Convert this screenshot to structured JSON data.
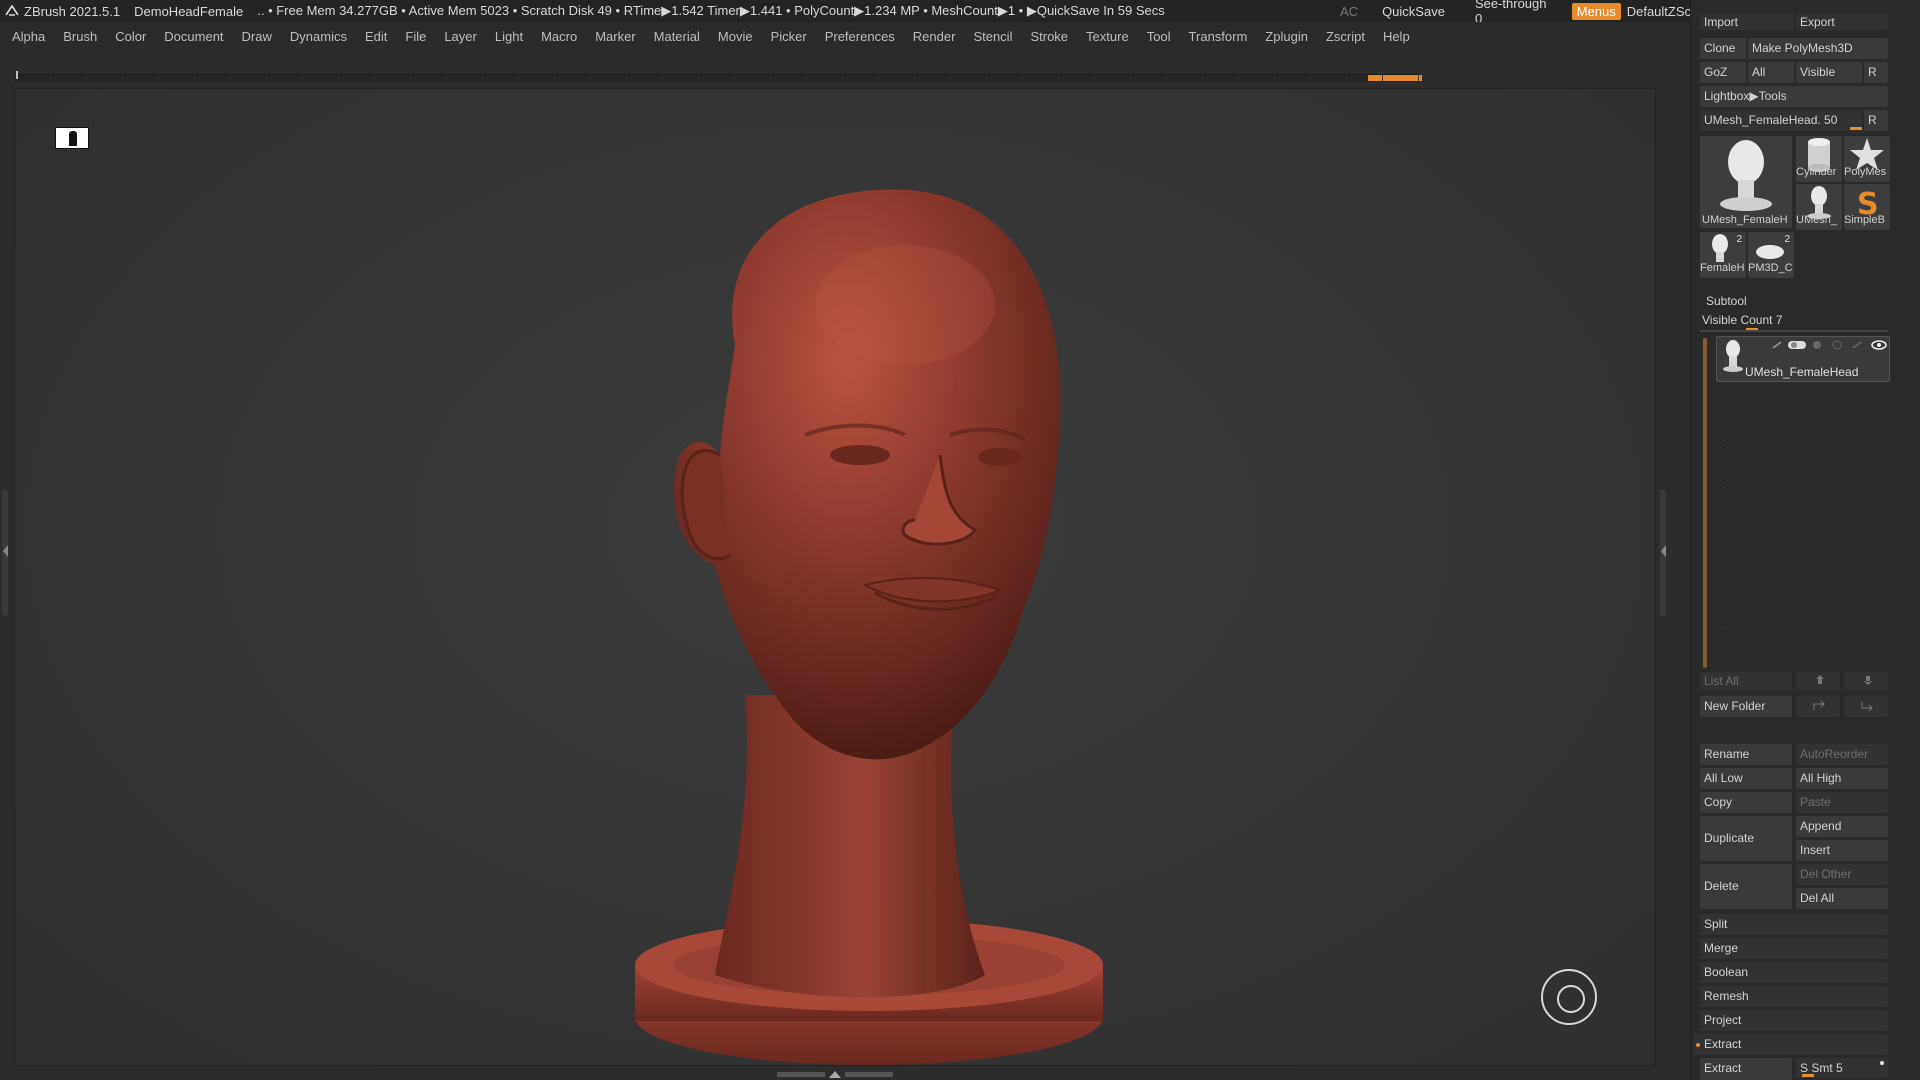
{
  "titlebar": {
    "app": "ZBrush 2021.5.1",
    "project": "DemoHeadFemale",
    "stats": ".. • Free Mem 34.277GB • Active Mem 5023 • Scratch Disk 49 • RTime▶1.542 Timer▶1.441 • PolyCount▶1.234 MP • MeshCount▶1 • ▶QuickSave In 59 Secs",
    "ac": "AC",
    "quicksave": "QuickSave",
    "see_through": "See-through  0",
    "menus": "Menus",
    "script": "DefaultZScript"
  },
  "menubar": [
    "Alpha",
    "Brush",
    "Color",
    "Document",
    "Draw",
    "Dynamics",
    "Edit",
    "File",
    "Layer",
    "Light",
    "Macro",
    "Marker",
    "Material",
    "Movie",
    "Picker",
    "Preferences",
    "Render",
    "Stencil",
    "Stroke",
    "Texture",
    "Tool",
    "Transform",
    "Zplugin",
    "Zscript",
    "Help"
  ],
  "tool_panel": {
    "import": "Import",
    "export": "Export",
    "clone": "Clone",
    "make_polymesh": "Make PolyMesh3D",
    "goz": "GoZ",
    "all": "All",
    "visible": "Visible",
    "r": "R",
    "lightbox": "Lightbox▶Tools",
    "current_tool": "UMesh_FemaleHead. 50",
    "tools": [
      {
        "label": "UMesh_FemaleH",
        "icon": "head-icon"
      },
      {
        "label": "Cylinder",
        "icon": "cylinder-icon"
      },
      {
        "label": "PolyMes",
        "icon": "star-icon"
      },
      {
        "label": "UMesh_",
        "icon": "head-icon"
      },
      {
        "label": "SimpleB",
        "icon": "simplebrush-icon"
      },
      {
        "label": "FemaleH",
        "icon": "head-icon",
        "count": "2"
      },
      {
        "label": "PM3D_C",
        "icon": "disc-icon",
        "count": "2"
      }
    ]
  },
  "subtool": {
    "title": "Subtool",
    "visible_count": "Visible Count 7",
    "item_name": "UMesh_FemaleHead",
    "list_all": "List All",
    "new_folder": "New Folder",
    "rename": "Rename",
    "autoreorder": "AutoReorder",
    "all_low": "All Low",
    "all_high": "All High",
    "copy": "Copy",
    "paste": "Paste",
    "duplicate": "Duplicate",
    "append": "Append",
    "insert": "Insert",
    "delete": "Delete",
    "del_other": "Del Other",
    "del_all": "Del All",
    "split": "Split",
    "merge": "Merge",
    "boolean": "Boolean",
    "remesh": "Remesh",
    "project": "Project",
    "extract": "Extract",
    "extract_btn": "Extract",
    "s_smt": "S Smt 5"
  },
  "colors": {
    "accent": "#e88b2c",
    "model": "#8e3a2e"
  }
}
